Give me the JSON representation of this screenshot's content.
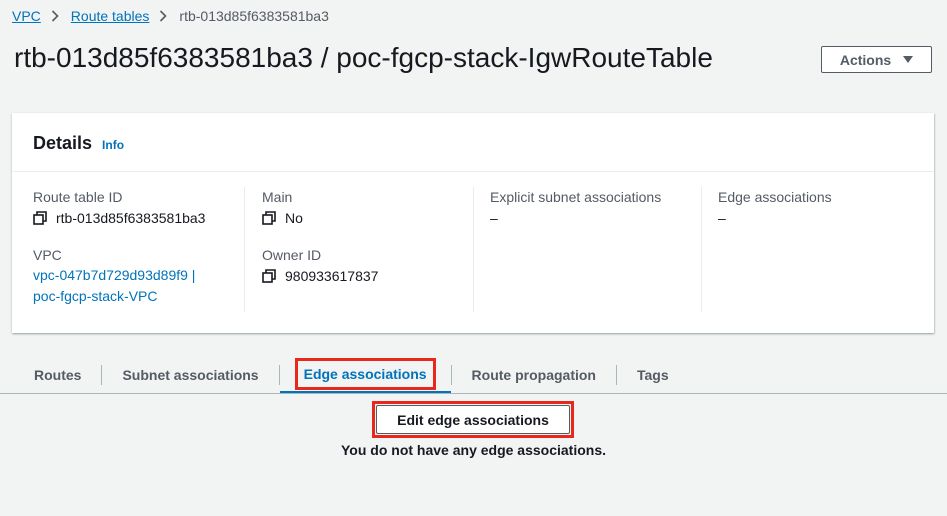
{
  "breadcrumb": {
    "items": [
      "VPC",
      "Route tables"
    ],
    "current": "rtb-013d85f6383581ba3"
  },
  "page": {
    "title": "rtb-013d85f6383581ba3 / poc-fgcp-stack-IgwRouteTable",
    "actions_label": "Actions"
  },
  "details": {
    "heading": "Details",
    "info_label": "Info",
    "route_table_id": {
      "label": "Route table ID",
      "value": "rtb-013d85f6383581ba3"
    },
    "vpc": {
      "label": "VPC",
      "value_line1": "vpc-047b7d729d93d89f9 |",
      "value_line2": "poc-fgcp-stack-VPC"
    },
    "main": {
      "label": "Main",
      "value": "No"
    },
    "owner_id": {
      "label": "Owner ID",
      "value": "980933617837"
    },
    "explicit_subnet_associations": {
      "label": "Explicit subnet associations",
      "value": "–"
    },
    "edge_associations": {
      "label": "Edge associations",
      "value": "–"
    }
  },
  "tabs": [
    "Routes",
    "Subnet associations",
    "Edge associations",
    "Route propagation",
    "Tags"
  ],
  "active_tab": "Edge associations",
  "edge_panel": {
    "edit_button": "Edit edge associations",
    "empty_message": "You do not have any edge associations."
  },
  "colors": {
    "link": "#0073bb",
    "highlight": "#e8281a",
    "background": "#f2f3f3"
  }
}
